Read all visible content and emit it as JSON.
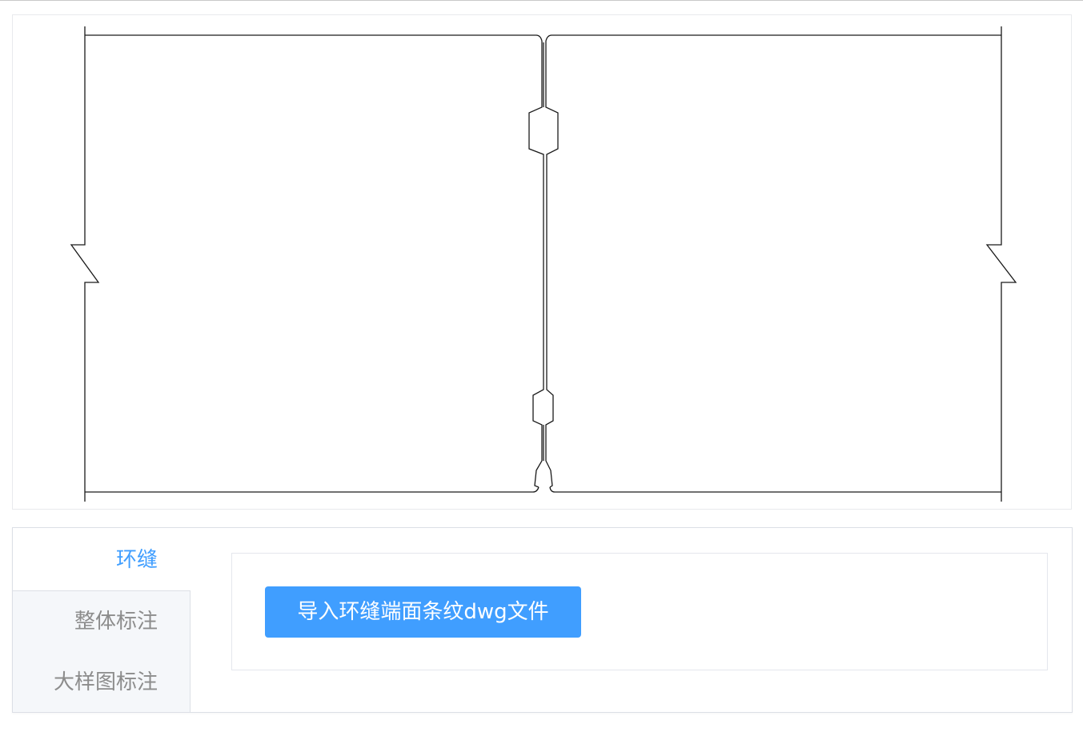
{
  "tabs": [
    {
      "label": "环缝",
      "active": true
    },
    {
      "label": "整体标注",
      "active": false
    },
    {
      "label": "大样图标注",
      "active": false
    }
  ],
  "content": {
    "import_button_label": "导入环缝端面条纹dwg文件"
  },
  "colors": {
    "accent": "#409eff",
    "tab_inactive_bg": "#f5f7fa",
    "line": "#1a1a1a"
  }
}
